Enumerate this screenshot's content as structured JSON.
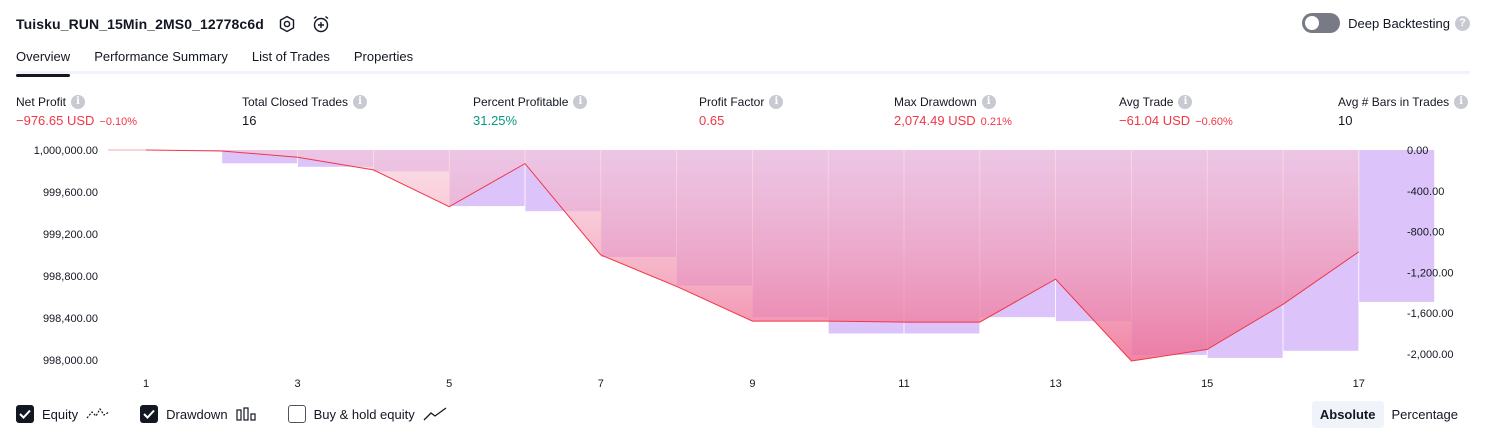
{
  "header": {
    "strategy_name": "Tuisku_RUN_15Min_2MS0_12778c6d",
    "settings_icon": "gear-icon",
    "alert_icon": "alarm-clock-plus-icon"
  },
  "deep_backtesting": {
    "label": "Deep Backtesting",
    "enabled": false,
    "help": "?"
  },
  "tabs": [
    {
      "label": "Overview",
      "active": true
    },
    {
      "label": "Performance Summary",
      "active": false
    },
    {
      "label": "List of Trades",
      "active": false
    },
    {
      "label": "Properties",
      "active": false
    }
  ],
  "metrics": {
    "net_profit": {
      "label": "Net Profit",
      "value": "−976.65 USD",
      "pct": "−0.10%"
    },
    "total_closed_trades": {
      "label": "Total Closed Trades",
      "value": "16"
    },
    "percent_profitable": {
      "label": "Percent Profitable",
      "value": "31.25%"
    },
    "profit_factor": {
      "label": "Profit Factor",
      "value": "0.65"
    },
    "max_drawdown": {
      "label": "Max Drawdown",
      "value": "2,074.49 USD",
      "pct": "0.21%"
    },
    "avg_trade": {
      "label": "Avg Trade",
      "value": "−61.04 USD",
      "pct": "−0.60%"
    },
    "avg_bars": {
      "label": "Avg # Bars in Trades",
      "value": "10"
    },
    "info_glyph": "i"
  },
  "chart_data": {
    "type": "line",
    "x_ticks": [
      "1",
      "3",
      "5",
      "7",
      "9",
      "11",
      "13",
      "15",
      "17"
    ],
    "left_axis": {
      "ticks": [
        "1,000,000.00",
        "999,600.00",
        "999,200.00",
        "998,800.00",
        "998,400.00",
        "998,000.00"
      ],
      "range": [
        997980,
        1000000
      ]
    },
    "right_axis": {
      "ticks": [
        "0.00",
        "-400.00",
        "-800.00",
        "-1,200.00",
        "-1,600.00",
        "-2,000.00"
      ],
      "range": [
        -2080,
        0
      ]
    },
    "series": [
      {
        "name": "Equity",
        "type": "line+area",
        "color": "#f23645",
        "x": [
          1,
          2,
          3,
          4,
          5,
          6,
          7,
          8,
          9,
          10,
          11,
          12,
          13,
          14,
          15,
          16,
          17
        ],
        "values": [
          1000000.0,
          999990.0,
          999930.0,
          999810.0,
          999460.0,
          999870.0,
          999000.0,
          998700.0,
          998370.0,
          998370.0,
          998360.0,
          998360.0,
          998770.0,
          997990.0,
          998100.0,
          998530.0,
          999030.0
        ]
      },
      {
        "name": "Drawdown",
        "type": "bar",
        "color": "#c59bf6",
        "x": [
          1,
          2,
          3,
          4,
          5,
          6,
          7,
          8,
          9,
          10,
          11,
          12,
          13,
          14,
          15,
          16,
          17
        ],
        "values": [
          -5,
          -130,
          -165,
          -210,
          -550,
          -600,
          -1050,
          -1330,
          -1640,
          -1800,
          -1800,
          -1640,
          -1680,
          -2010,
          -2040,
          -1970,
          -1490
        ]
      }
    ],
    "buy_hold": {
      "name": "Buy & hold equity",
      "visible": false
    },
    "grid": false
  },
  "legend": {
    "equity": {
      "label": "Equity",
      "checked": true
    },
    "drawdown": {
      "label": "Drawdown",
      "checked": true
    },
    "buy_hold": {
      "label": "Buy & hold equity",
      "checked": false
    }
  },
  "display_mode": {
    "absolute": "Absolute",
    "percentage": "Percentage",
    "selected": "Absolute"
  },
  "colors": {
    "accent": "#131722",
    "loss": "#f23645",
    "profit": "#089981",
    "drawdown": "#c59bf6",
    "equity_fill": "#f2a6bc"
  }
}
